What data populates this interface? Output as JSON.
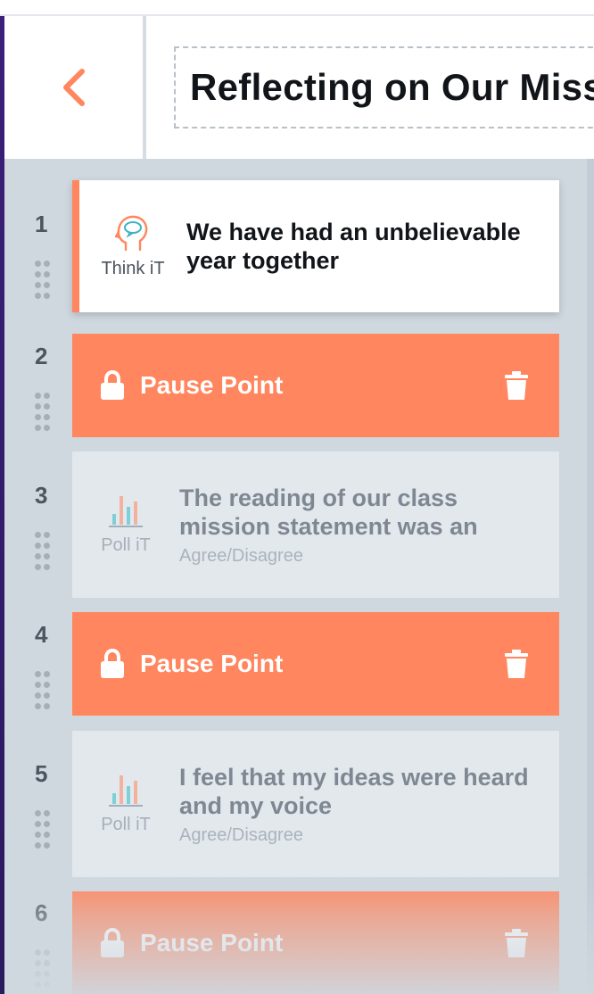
{
  "header": {
    "title": "Reflecting on Our Mission Statement",
    "back_icon": "chevron-left-icon",
    "accent": "#ff865e"
  },
  "items": [
    {
      "number": "1",
      "type": "think",
      "type_label": "Think iT",
      "icon": "head-thought-icon",
      "prompt": "We have had an unbelievable year together",
      "sub": ""
    },
    {
      "number": "2",
      "type": "pause",
      "label": "Pause Point",
      "icon": "lock-icon",
      "action_icon": "trash-icon"
    },
    {
      "number": "3",
      "type": "poll",
      "type_label": "Poll iT",
      "icon": "bar-chart-icon",
      "prompt": "The reading of our class mission statement was an",
      "sub": "Agree/Disagree"
    },
    {
      "number": "4",
      "type": "pause",
      "label": "Pause Point",
      "icon": "lock-icon",
      "action_icon": "trash-icon"
    },
    {
      "number": "5",
      "type": "poll",
      "type_label": "Poll iT",
      "icon": "bar-chart-icon",
      "prompt": "I feel that my ideas were heard and my voice",
      "sub": "Agree/Disagree"
    },
    {
      "number": "6",
      "type": "pause",
      "label": "Pause Point",
      "icon": "lock-icon",
      "action_icon": "trash-icon"
    }
  ],
  "colors": {
    "pause_bg": "#ff865e",
    "think_border": "#ff865e",
    "poll_bg": "#e3e8ed",
    "page_bg": "#cfd7df"
  }
}
